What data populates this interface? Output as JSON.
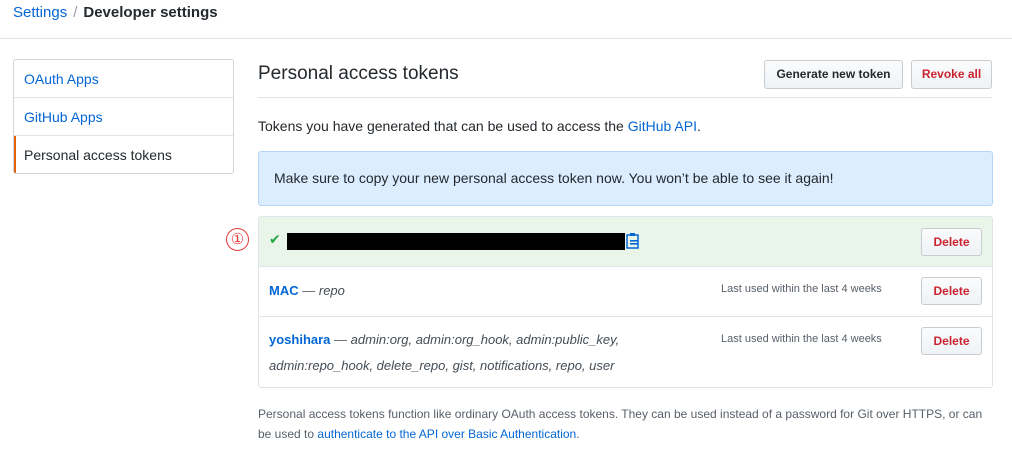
{
  "breadcrumb": {
    "parent": "Settings",
    "separator": "/",
    "current": "Developer settings"
  },
  "sidebar": {
    "items": [
      {
        "label": "OAuth Apps",
        "selected": false
      },
      {
        "label": "GitHub Apps",
        "selected": false
      },
      {
        "label": "Personal access tokens",
        "selected": true
      }
    ]
  },
  "header": {
    "title": "Personal access tokens",
    "generate_label": "Generate new token",
    "revoke_label": "Revoke all"
  },
  "intro": {
    "text": "Tokens you have generated that can be used to access the ",
    "link": "GitHub API",
    "end": "."
  },
  "flash": {
    "message": "Make sure to copy your new personal access token now. You won’t be able to see it again!"
  },
  "annotation_marker": "①",
  "tokens": [
    {
      "new": true,
      "value_redacted": true,
      "icon": "check-icon",
      "copy_icon": "clipboard-icon",
      "delete_label": "Delete"
    },
    {
      "name": "MAC",
      "separator": "—",
      "scopes": "repo",
      "last_used": "Last used within the last 4 weeks",
      "delete_label": "Delete"
    },
    {
      "name": "yoshihara",
      "separator": "—",
      "scopes_line1": "admin:org, admin:org_hook, admin:public_key,",
      "scopes_line2": "admin:repo_hook, delete_repo, gist, notifications, repo, user",
      "last_used": "Last used within the last 4 weeks",
      "delete_label": "Delete"
    }
  ],
  "footnote": {
    "text": "Personal access tokens function like ordinary OAuth access tokens. They can be used instead of a password for Git over HTTPS, or can be used to ",
    "link": "authenticate to the API over Basic Authentication",
    "end": "."
  },
  "colors": {
    "link": "#0366d6",
    "danger": "#cb2431",
    "success": "#28a745",
    "flash_bg": "#dbedff",
    "new_token_bg": "#eaf5ea",
    "selected_accent": "#e36209"
  }
}
